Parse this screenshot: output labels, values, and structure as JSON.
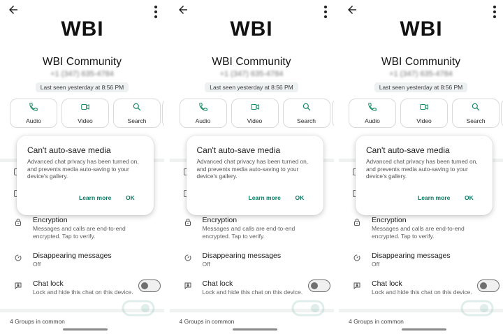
{
  "screens": [
    {
      "contact_name": "WBI Community",
      "phone": "+1 (347) 635-4784",
      "last_seen": "Last seen yesterday at 8:56 PM",
      "actions": [
        {
          "label": "Audio",
          "icon": "phone-icon"
        },
        {
          "label": "Video",
          "icon": "video-icon"
        },
        {
          "label": "Search",
          "icon": "search-icon"
        }
      ],
      "dialog": {
        "title": "Can't auto-save media",
        "body": "Advanced chat privacy has been turned on, and prevents media auto-saving to your device's gallery.",
        "learn_more": "Learn more",
        "ok": "OK"
      },
      "encryption": {
        "title": "Encryption",
        "subtitle": "Messages and calls are end-to-end encrypted. Tap to verify."
      },
      "disappearing": {
        "title": "Disappearing messages",
        "subtitle": "Off"
      },
      "chat_lock": {
        "title": "Chat lock",
        "subtitle": "Lock and hide this chat on this device.",
        "enabled": false
      },
      "groups_in_common": "4 Groups in common"
    },
    {
      "contact_name": "WBI Community",
      "phone": "+1 (347) 635-4784",
      "last_seen": "Last seen yesterday at 8:56 PM",
      "actions": [
        {
          "label": "Audio",
          "icon": "phone-icon"
        },
        {
          "label": "Video",
          "icon": "video-icon"
        },
        {
          "label": "Search",
          "icon": "search-icon"
        }
      ],
      "dialog": {
        "title": "Can't auto-save media",
        "body": "Advanced chat privacy has been turned on, and prevents media auto-saving to your device's gallery.",
        "learn_more": "Learn more",
        "ok": "OK"
      },
      "encryption": {
        "title": "Encryption",
        "subtitle": "Messages and calls are end-to-end encrypted. Tap to verify."
      },
      "disappearing": {
        "title": "Disappearing messages",
        "subtitle": "Off"
      },
      "chat_lock": {
        "title": "Chat lock",
        "subtitle": "Lock and hide this chat on this device.",
        "enabled": false
      },
      "groups_in_common": "4 Groups in common"
    },
    {
      "contact_name": "WBI Community",
      "phone": "+1 (347) 635-4784",
      "last_seen": "Last seen yesterday at 8:56 PM",
      "actions": [
        {
          "label": "Audio",
          "icon": "phone-icon"
        },
        {
          "label": "Video",
          "icon": "video-icon"
        },
        {
          "label": "Search",
          "icon": "search-icon"
        }
      ],
      "dialog": {
        "title": "Can't auto-save media",
        "body": "Advanced chat privacy has been turned on, and prevents media auto-saving to your device's gallery.",
        "learn_more": "Learn more",
        "ok": "OK"
      },
      "encryption": {
        "title": "Encryption",
        "subtitle": "Messages and calls are end-to-end encrypted. Tap to verify."
      },
      "disappearing": {
        "title": "Disappearing messages",
        "subtitle": "Off"
      },
      "chat_lock": {
        "title": "Chat lock",
        "subtitle": "Lock and hide this chat on this device.",
        "enabled": false
      },
      "groups_in_common": "4 Groups in common"
    }
  ],
  "logo_text": "WBI",
  "colors": {
    "accent": "#0b7a63",
    "icon_green": "#1a8a62",
    "background": "#ffffff"
  }
}
